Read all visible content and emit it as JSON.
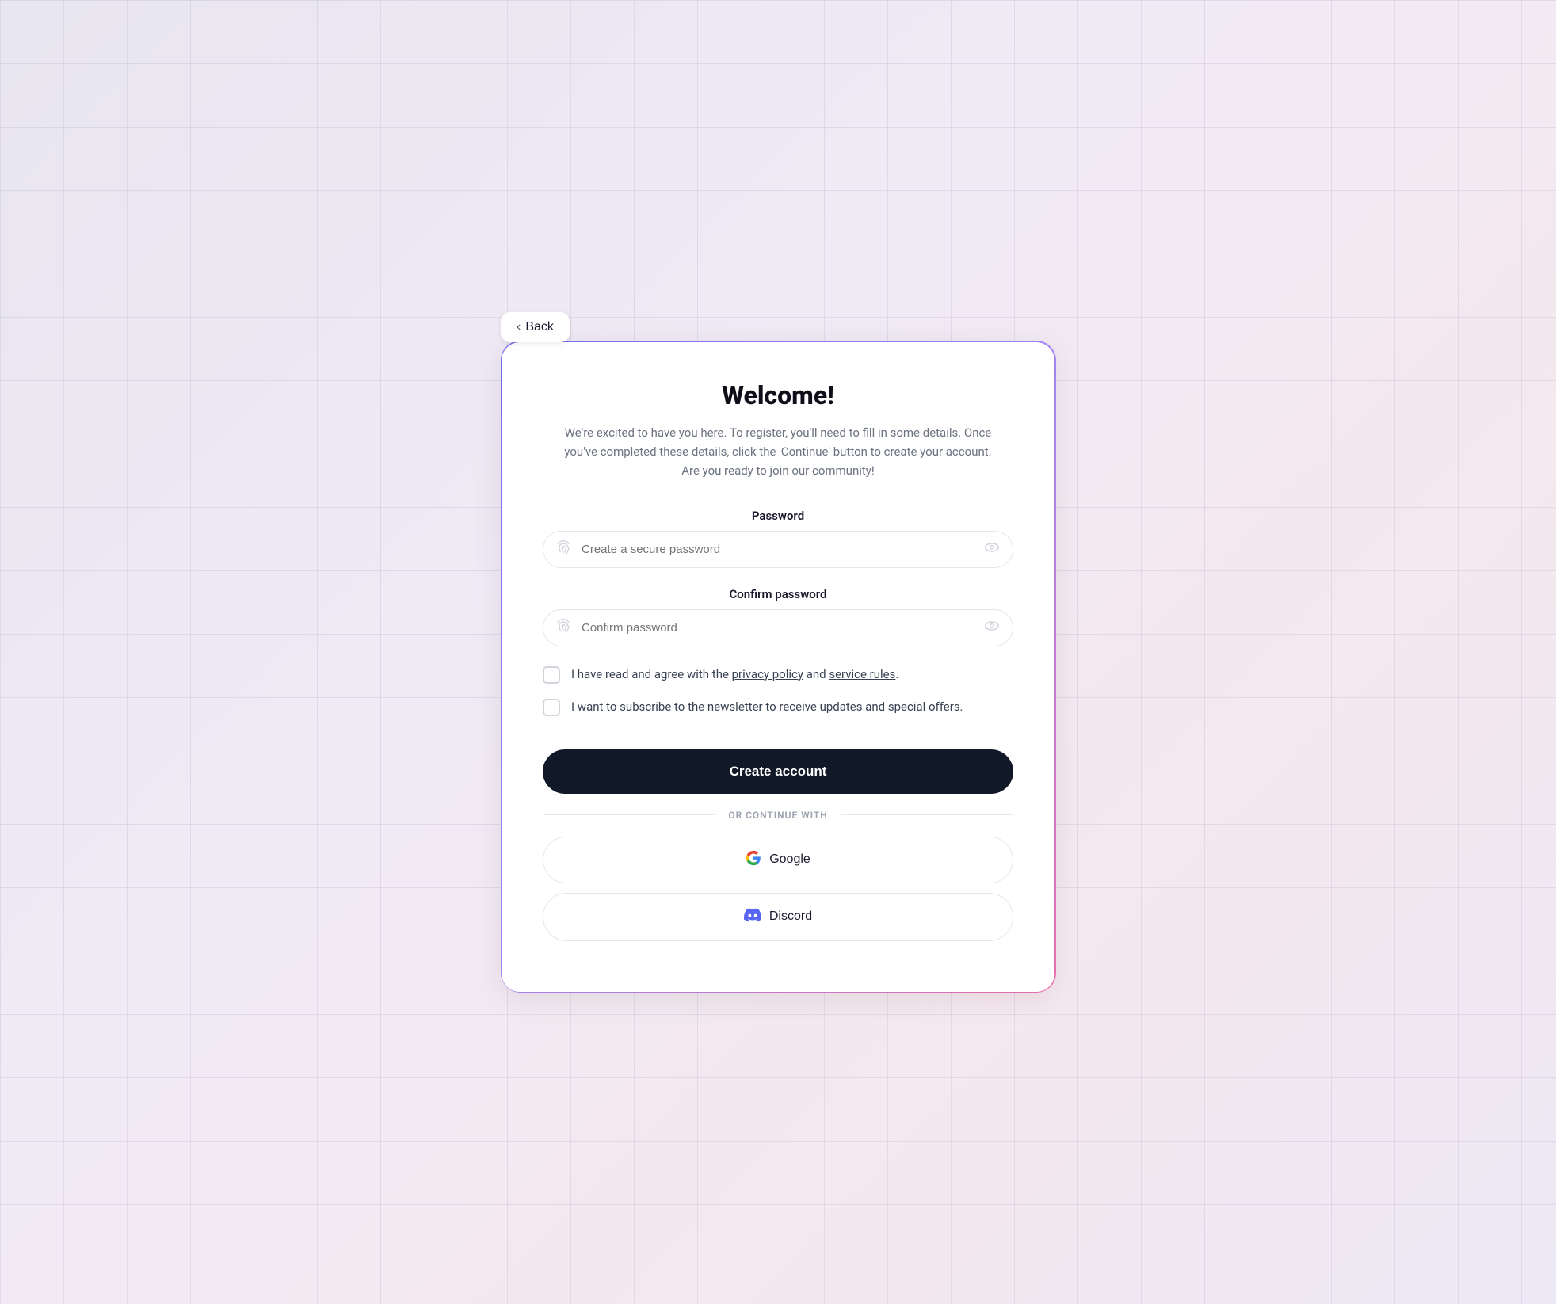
{
  "back_button": {
    "label": "Back"
  },
  "header": {
    "title": "Welcome!",
    "subtitle": "We're excited to have you here. To register, you'll need to fill in some details. Once you've completed these details, click the 'Continue' button to create your account. Are you ready to join our community!"
  },
  "password_field": {
    "label": "Password",
    "placeholder": "Create a secure password"
  },
  "confirm_password_field": {
    "label": "Confirm password",
    "placeholder": "Confirm password"
  },
  "checkboxes": {
    "privacy": {
      "label_before": "I have read and agree with the ",
      "link1": "privacy policy",
      "label_middle": " and ",
      "link2": "service rules",
      "label_after": "."
    },
    "newsletter": {
      "label": "I want to subscribe to the newsletter to receive updates and special offers."
    }
  },
  "create_account_btn": {
    "label": "Create account"
  },
  "or_divider": {
    "text": "OR CONTINUE WITH"
  },
  "social_buttons": {
    "google": {
      "label": "Google"
    },
    "discord": {
      "label": "Discord"
    }
  }
}
